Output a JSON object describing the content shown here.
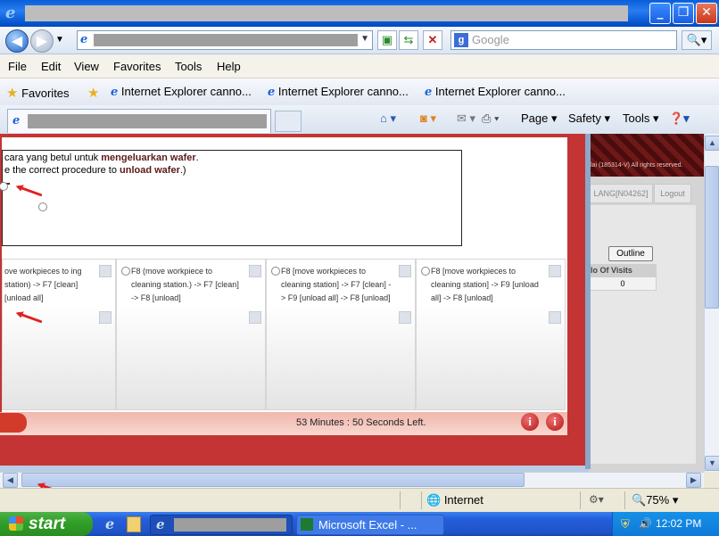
{
  "browser": {
    "window_buttons": {
      "minimize": "_",
      "maximize": "❐",
      "close": "✕"
    },
    "search": {
      "placeholder": "Google",
      "engine_icon": "g-icon"
    },
    "menu": [
      "File",
      "Edit",
      "View",
      "Favorites",
      "Tools",
      "Help"
    ],
    "favorites": {
      "label": "Favorites",
      "links": [
        "Internet Explorer canno...",
        "Internet Explorer canno...",
        "Internet Explorer canno..."
      ]
    },
    "command_bar": {
      "page": "Page ▾",
      "safety": "Safety ▾",
      "tools": "Tools ▾"
    },
    "status": {
      "zone": "Internet",
      "zoom": "75%"
    }
  },
  "exam": {
    "question_line1_prefix": "cara yang betul untuk ",
    "question_line1_bold": "mengeluarkan wafer",
    "question_line1_suffix": ".",
    "question_line2_prefix": "e the correct procedure to ",
    "question_line2_bold": "unload wafer",
    "question_line2_suffix": ".)",
    "options": [
      "ove workpieces to ing station) -> F7 [clean] [unload all]",
      "F8 (move workpiece to cleaning station.) -> F7 [clean] -> F8 [unload]",
      "F8 [move workpieces to cleaning station] -> F7 [clean] -> F9 [unload all] -> F8 [unload]",
      "F8 [move workpieces to cleaning station] -> F9 [unload all] -> F8 [unload]"
    ],
    "time_left": "53 Minutes : 50 Seconds Left.",
    "info_buttons": [
      "i",
      "i"
    ]
  },
  "sidebar": {
    "header_small": "lai (185314-V) All rights reserved.",
    "user_tab": "LANG[N04262]",
    "logout": "Logout",
    "outline": "Outline",
    "visits_header": "lo Of Visits",
    "visits_value": "0"
  },
  "taskbar": {
    "start": "start",
    "excel": "Microsoft Excel - ...",
    "clock": "12:02 PM"
  },
  "colors": {
    "popup_frame": "#c43434",
    "arrow": "#e02020",
    "taskbar": "#245edb",
    "start": "#32a028"
  }
}
